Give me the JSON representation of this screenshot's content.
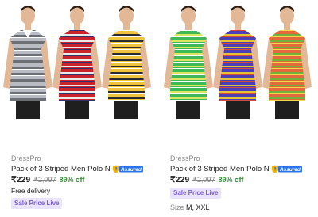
{
  "products": [
    {
      "brand": "DressPro",
      "title": "Pack of 3 Striped Men Polo Neck ...",
      "assured_label": "Assured",
      "price": "₹229",
      "mrp": "₹2,097",
      "discount": "89% off",
      "delivery": "Free delivery",
      "badge": "Sale Price Live",
      "image_alt": "three models wearing striped polo shirts in grey, red and yellow"
    },
    {
      "brand": "DressPro",
      "title": "Pack of 3 Striped Men Polo Neck ...",
      "assured_label": "Assured",
      "price": "₹229",
      "mrp": "₹2,097",
      "discount": "89% off",
      "badge": "Sale Price Live",
      "size_label": "Size",
      "size_value": "M, XXL",
      "image_alt": "three models wearing striped polo shirts in green, blue and orange"
    }
  ],
  "colors": {
    "accent_green": "#388e3c",
    "assured_blue": "#2874f0",
    "badge_bg": "#e9e4fb",
    "badge_text": "#7b5ecf"
  }
}
